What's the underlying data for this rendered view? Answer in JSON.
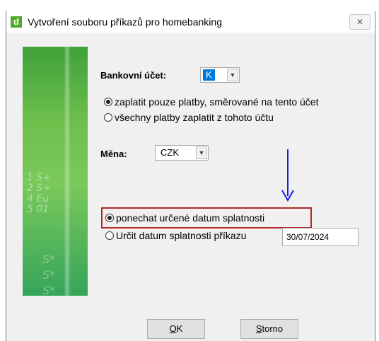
{
  "window": {
    "title": "Vytvoření souboru příkazů pro homebanking",
    "icon_letter": "d",
    "close_glyph": "✕"
  },
  "banner": {
    "deco_lines": [
      "1 S+",
      "2 S+",
      "4 Eu",
      "5 01"
    ],
    "deco_lower": [
      "S*",
      "S*",
      "S*"
    ]
  },
  "account": {
    "label": "Bankovní účet:",
    "value": "K",
    "radio_this": "zaplatit pouze platby, směrované na tento účet",
    "radio_all": "všechny platby zaplatit z tohoto účtu"
  },
  "currency": {
    "label": "Měna:",
    "value": "CZK"
  },
  "due_date": {
    "keep_label": "ponechat určené datum splatnosti",
    "set_label": "Určit datum splatnosti příkazu",
    "date_value": "30/07/2024"
  },
  "buttons": {
    "ok_underline": "O",
    "ok_rest": "K",
    "cancel_underline": "S",
    "cancel_rest": "torno"
  },
  "colors": {
    "highlight": "#b02a2a",
    "arrow": "#1a1ae6",
    "banner_green": "#6dbf4c",
    "selection": "#0078d7"
  }
}
